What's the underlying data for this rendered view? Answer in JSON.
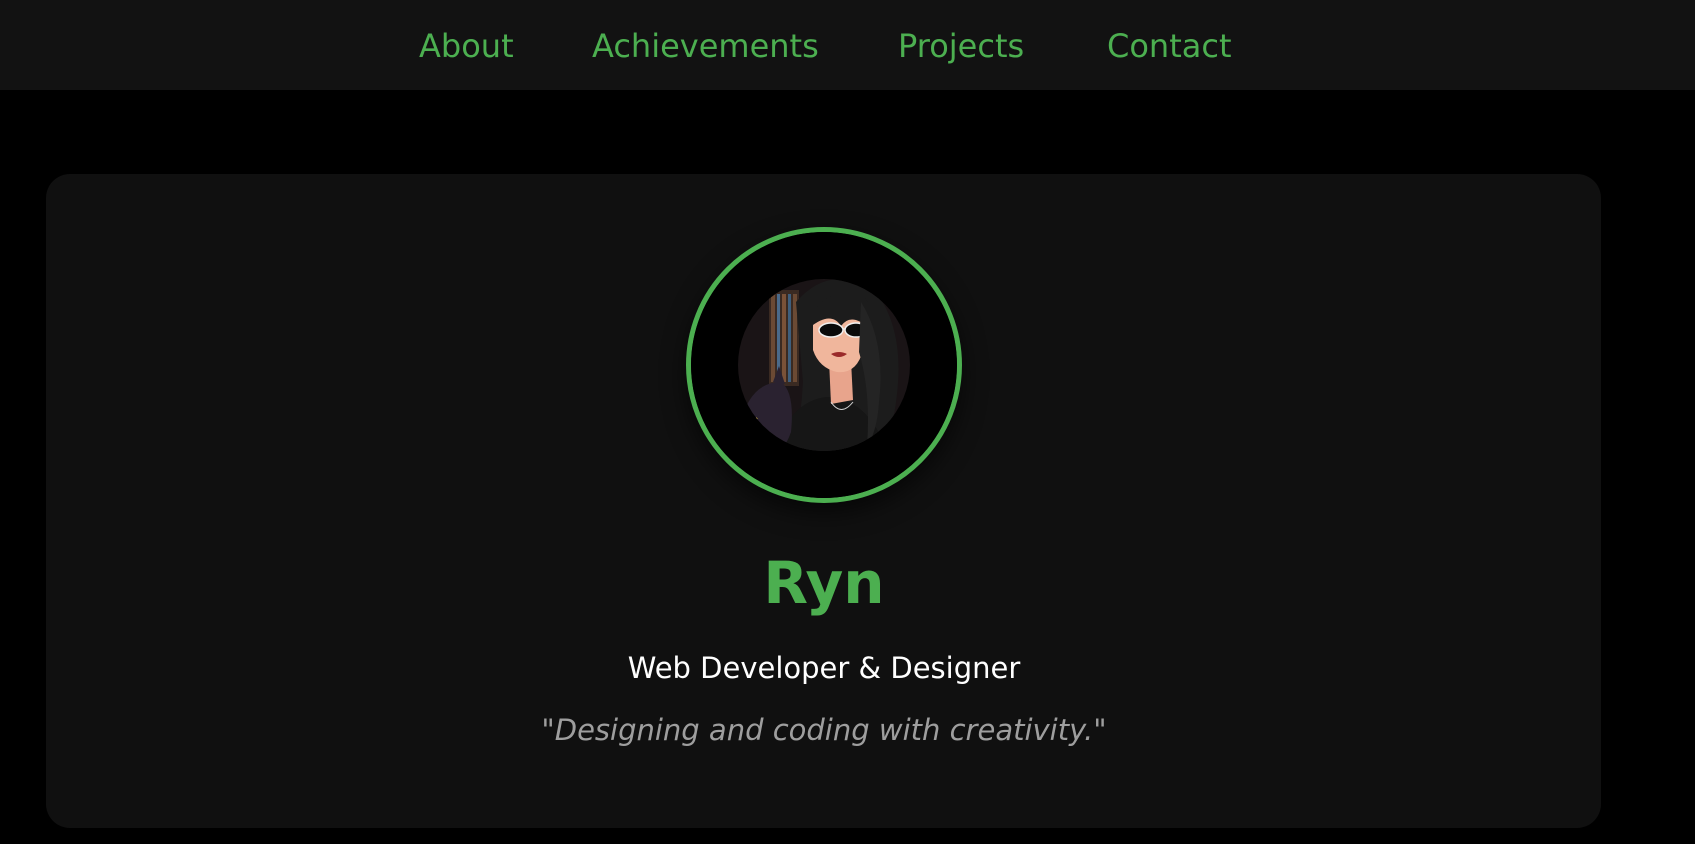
{
  "nav": {
    "items": [
      {
        "label": "About"
      },
      {
        "label": "Achievements"
      },
      {
        "label": "Projects"
      },
      {
        "label": "Contact"
      }
    ]
  },
  "profile": {
    "name": "Ryn",
    "role": "Web Developer & Designer",
    "tagline": "\"Designing and coding with creativity.\"",
    "avatar_icon": "avatar-illustration"
  },
  "colors": {
    "accent": "#4caf50",
    "page_background": "#000000",
    "nav_background": "#121212",
    "card_background": "#101010",
    "tagline_text": "#9e9e9e"
  }
}
